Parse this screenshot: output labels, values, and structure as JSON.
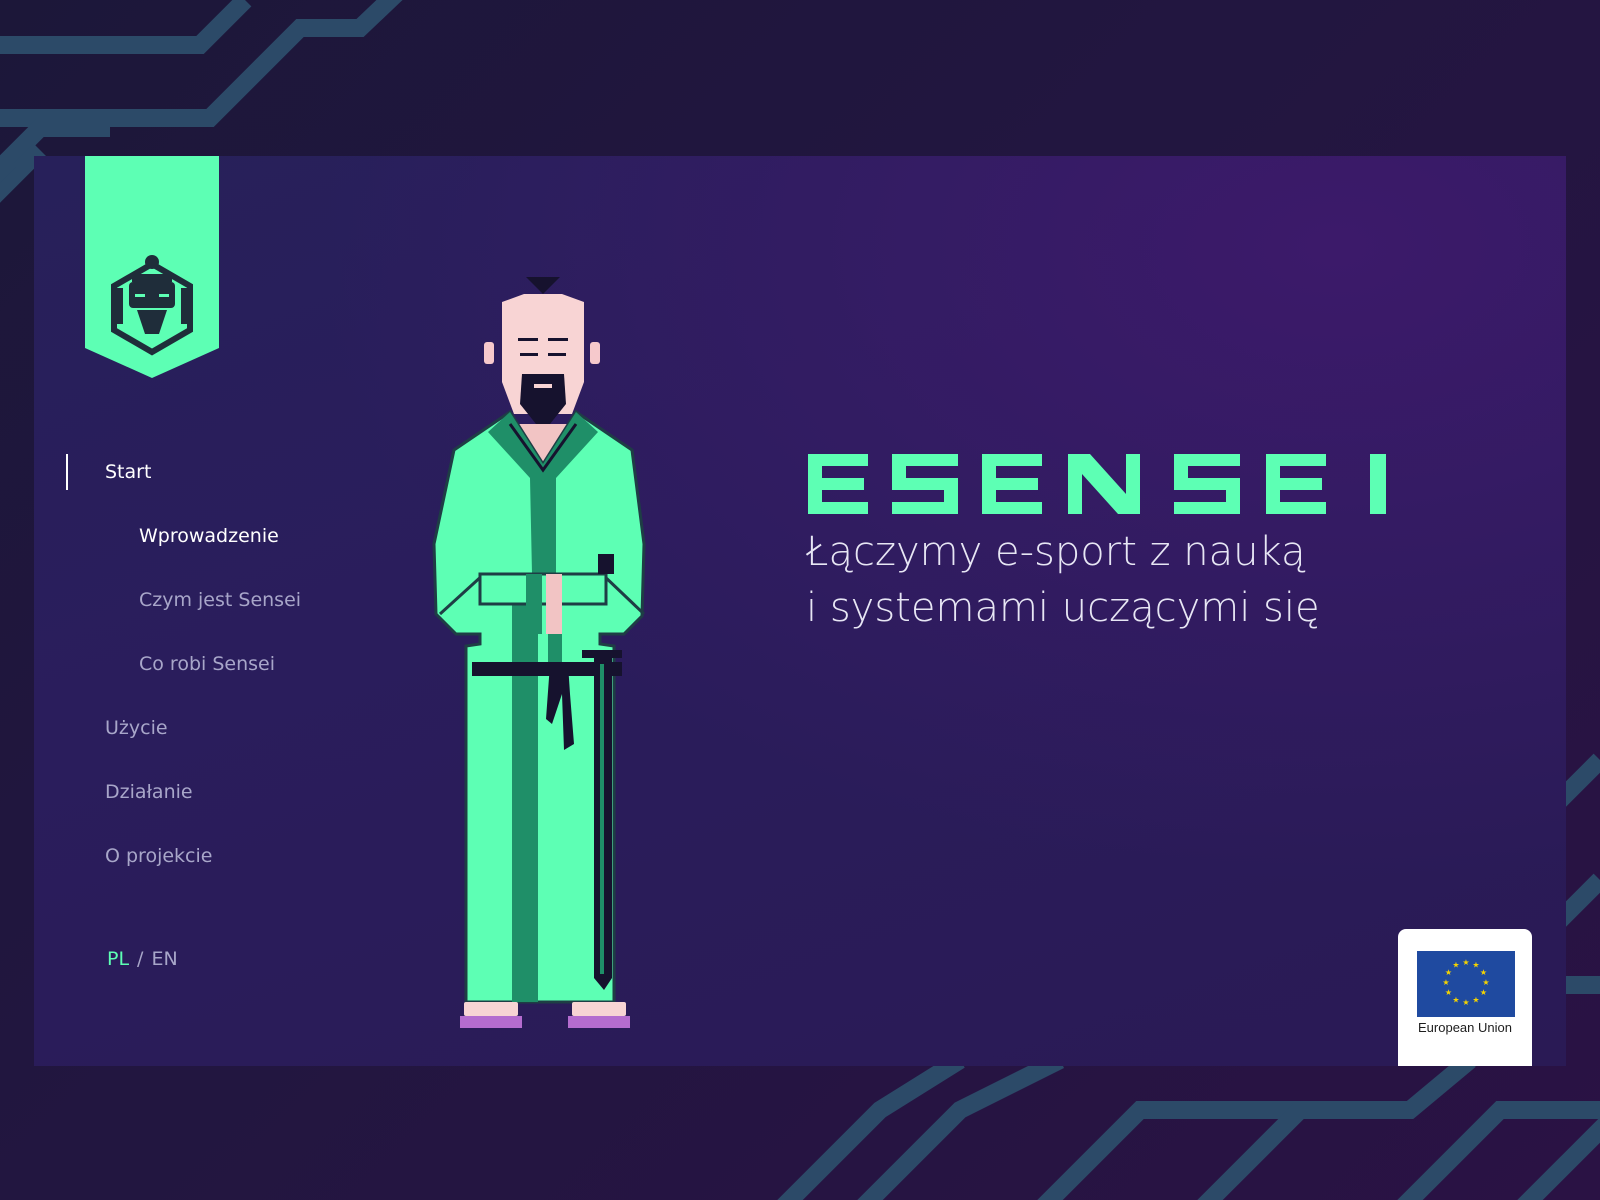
{
  "brand": {
    "name": "ESENSEI",
    "accent_color": "#5dffb4"
  },
  "nav": {
    "items": [
      {
        "label": "Start",
        "state": "active"
      },
      {
        "label": "Wprowadzenie",
        "state": "sub-active"
      },
      {
        "label": "Czym jest Sensei",
        "state": "sub"
      },
      {
        "label": "Co robi Sensei",
        "state": "sub"
      },
      {
        "label": "Użycie",
        "state": "normal"
      },
      {
        "label": "Działanie",
        "state": "normal"
      },
      {
        "label": "O projekcie",
        "state": "normal"
      }
    ]
  },
  "lang": {
    "pl": "PL",
    "separator": "/",
    "en": "EN",
    "active": "PL"
  },
  "hero": {
    "tagline_line1": "Łączymy e-sport z nauką",
    "tagline_line2": "i systemami uczącymi się"
  },
  "eu_badge": {
    "label": "European Union",
    "flag_color": "#1f4aa0",
    "star_color": "#f5d400"
  },
  "icons": {
    "logo": "samurai-head-logo",
    "character": "sensei-illustration"
  }
}
